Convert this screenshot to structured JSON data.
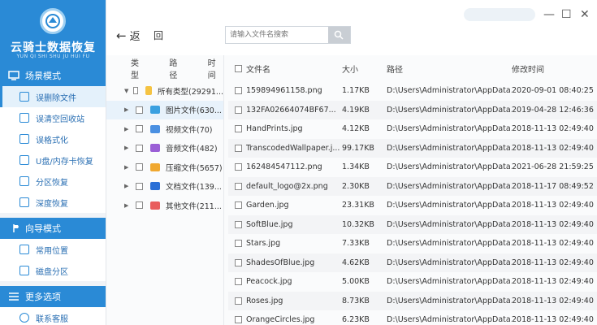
{
  "app": {
    "name": "云骑士数据恢复",
    "subtitle": "YUN QI SHI SHU JU HUI FU"
  },
  "sidebar": {
    "sections": [
      {
        "title": "场景模式",
        "items": [
          {
            "label": "误删除文件",
            "active": true
          },
          {
            "label": "误清空回收站"
          },
          {
            "label": "误格式化"
          },
          {
            "label": "U盘/内存卡恢复"
          },
          {
            "label": "分区恢复"
          },
          {
            "label": "深度恢复"
          }
        ]
      },
      {
        "title": "向导模式",
        "items": [
          {
            "label": "常用位置"
          },
          {
            "label": "磁盘分区"
          }
        ]
      },
      {
        "title": "更多选项",
        "items": [
          {
            "label": "联系客服"
          }
        ]
      }
    ]
  },
  "topbar": {
    "back_label": "返",
    "return_label": "回",
    "search_placeholder": "请输入文件名搜索",
    "window_controls": [
      "—",
      "☐",
      "✕"
    ]
  },
  "tree": {
    "headers": [
      "类型",
      "路径",
      "时间"
    ],
    "rows": [
      {
        "label": "所有类型(29291...",
        "arrow": "▼",
        "icon_color": "#f5c342",
        "root": true
      },
      {
        "label": "图片文件(630...",
        "arrow": "▶",
        "icon_color": "#3aa0e0",
        "selected": true
      },
      {
        "label": "视频文件(70)",
        "arrow": "▶",
        "icon_color": "#4a90e2"
      },
      {
        "label": "音频文件(482)",
        "arrow": "▶",
        "icon_color": "#9a5fd6"
      },
      {
        "label": "压缩文件(5657)",
        "arrow": "▶",
        "icon_color": "#f0a830"
      },
      {
        "label": "文档文件(139...",
        "arrow": "▶",
        "icon_color": "#2a6fd6"
      },
      {
        "label": "其他文件(211...",
        "arrow": "▶",
        "icon_color": "#e85d5d"
      }
    ]
  },
  "table": {
    "headers": [
      "文件名",
      "大小",
      "路径",
      "修改时间"
    ],
    "rows": [
      {
        "name": "159894961158.png",
        "size": "1.17KB",
        "path": "D:\\Users\\Administrator\\AppData...",
        "time": "2020-09-01 08:40:25"
      },
      {
        "name": "132FA02664074BF67...",
        "size": "4.19KB",
        "path": "D:\\Users\\Administrator\\AppData...",
        "time": "2019-04-28 12:46:36"
      },
      {
        "name": "HandPrints.jpg",
        "size": "4.12KB",
        "path": "D:\\Users\\Administrator\\AppData...",
        "time": "2018-11-13 02:49:40"
      },
      {
        "name": "TranscodedWallpaper.j...",
        "size": "99.17KB",
        "path": "D:\\Users\\Administrator\\AppData...",
        "time": "2018-11-13 02:49:40"
      },
      {
        "name": "162484547112.png",
        "size": "1.34KB",
        "path": "D:\\Users\\Administrator\\AppData...",
        "time": "2021-06-28 21:59:25"
      },
      {
        "name": "default_logo@2x.png",
        "size": "2.30KB",
        "path": "D:\\Users\\Administrator\\AppData...",
        "time": "2018-11-17 08:49:52"
      },
      {
        "name": "Garden.jpg",
        "size": "23.31KB",
        "path": "D:\\Users\\Administrator\\AppData...",
        "time": "2018-11-13 02:49:40"
      },
      {
        "name": "SoftBlue.jpg",
        "size": "10.32KB",
        "path": "D:\\Users\\Administrator\\AppData...",
        "time": "2018-11-13 02:49:40"
      },
      {
        "name": "Stars.jpg",
        "size": "7.33KB",
        "path": "D:\\Users\\Administrator\\AppData...",
        "time": "2018-11-13 02:49:40"
      },
      {
        "name": "ShadesOfBlue.jpg",
        "size": "4.62KB",
        "path": "D:\\Users\\Administrator\\AppData...",
        "time": "2018-11-13 02:49:40"
      },
      {
        "name": "Peacock.jpg",
        "size": "5.00KB",
        "path": "D:\\Users\\Administrator\\AppData...",
        "time": "2018-11-13 02:49:40"
      },
      {
        "name": "Roses.jpg",
        "size": "8.73KB",
        "path": "D:\\Users\\Administrator\\AppData...",
        "time": "2018-11-13 02:49:40"
      },
      {
        "name": "OrangeCircles.jpg",
        "size": "6.23KB",
        "path": "D:\\Users\\Administrator\\AppData...",
        "time": "2018-11-13 02:49:40"
      }
    ]
  },
  "colors": {
    "brand": "#2a8ad6",
    "active_bg": "#e4f1fb"
  }
}
